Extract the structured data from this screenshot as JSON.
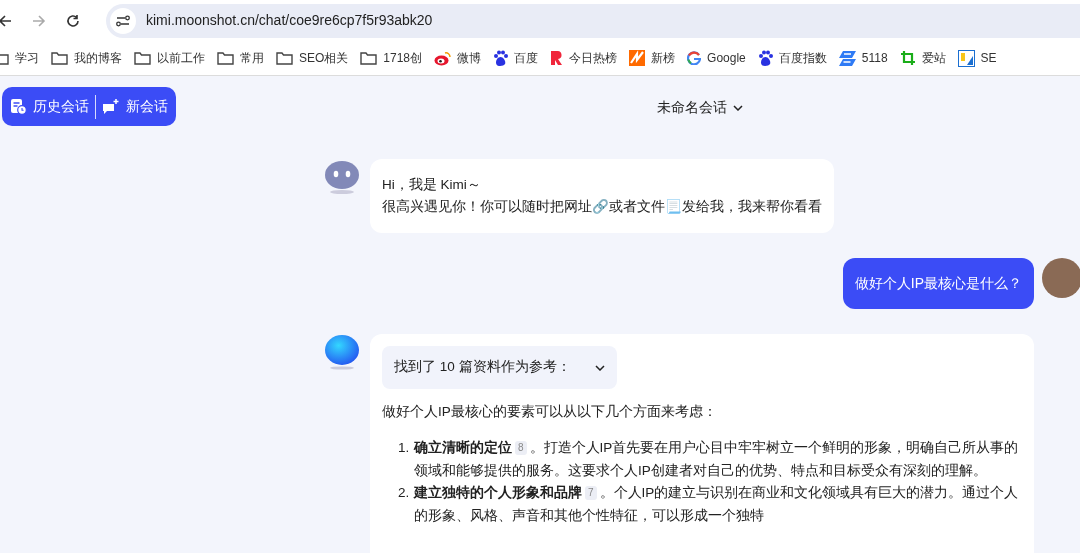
{
  "browser": {
    "url": "kimi.moonshot.cn/chat/coe9re6cp7f5r93abk20"
  },
  "bookmarks": [
    {
      "kind": "folder",
      "label": "学习"
    },
    {
      "kind": "folder",
      "label": "我的博客"
    },
    {
      "kind": "folder",
      "label": "以前工作"
    },
    {
      "kind": "folder",
      "label": "常用"
    },
    {
      "kind": "folder",
      "label": "SEO相关"
    },
    {
      "kind": "folder",
      "label": "1718创"
    },
    {
      "kind": "weibo",
      "label": "微博"
    },
    {
      "kind": "paw",
      "label": "百度"
    },
    {
      "kind": "r",
      "label": "今日热榜"
    },
    {
      "kind": "zigzag",
      "label": "新榜"
    },
    {
      "kind": "g",
      "label": "Google"
    },
    {
      "kind": "paw",
      "label": "百度指数"
    },
    {
      "kind": "s",
      "label": "5118"
    },
    {
      "kind": "crop",
      "label": "爱站"
    },
    {
      "kind": "split",
      "label": "SE"
    }
  ],
  "toolbar": {
    "history": "历史会话",
    "new_chat": "新会话"
  },
  "conversation_title": "未命名会话",
  "messages": [
    {
      "kind": "bot_greeting",
      "lines": [
        "Hi，我是 Kimi～",
        "很高兴遇见你！你可以随时把网址🔗或者文件📃发给我，我来帮你看看"
      ]
    },
    {
      "kind": "user",
      "text": "做好个人IP最核心是什么？"
    },
    {
      "kind": "bot_answer",
      "sources": {
        "label": "找到了 10 篇资料作为参考：",
        "expanded": false
      },
      "intro": "做好个人IP最核心的要素可以从以下几个方面来考虑：",
      "items": [
        {
          "number": "1.",
          "title": "确立清晰的定位",
          "citation": "8",
          "text": "。打造个人IP首先要在用户心目中牢牢树立一个鲜明的形象，明确自己所从事的领域和能够提供的服务。这要求个人IP创建者对自己的优势、特点和目标受众有深刻的理解。"
        },
        {
          "number": "2.",
          "title": "建立独特的个人形象和品牌",
          "citation": "7",
          "text": "。个人IP的建立与识别在商业和文化领域具有巨大的潜力。通过个人的形象、风格、声音和其他个性特征，可以形成一个独特"
        }
      ]
    }
  ]
}
